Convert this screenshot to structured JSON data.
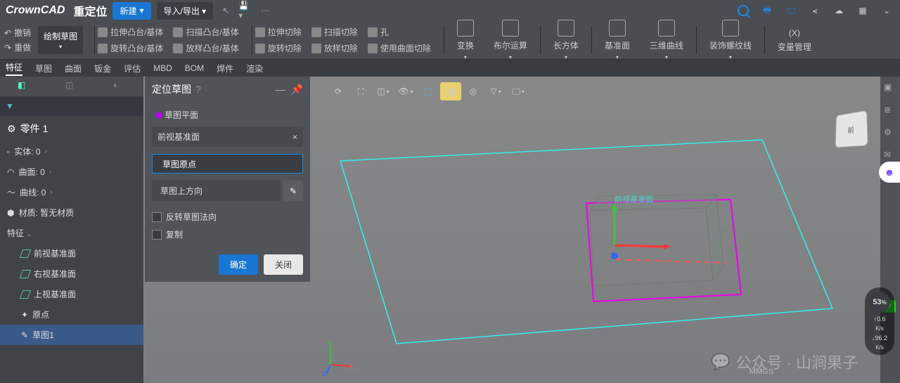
{
  "app": {
    "logo": "CrownCAD",
    "title": "重定位"
  },
  "topbar": {
    "new": "新建",
    "io": "导入/导出"
  },
  "undo": "撤销",
  "redo": "重做",
  "sketch_btn": "绘制草图",
  "tools": {
    "r1": [
      "拉伸凸台/基体",
      "扫描凸台/基体",
      "拉伸切除",
      "扫描切除"
    ],
    "r2": [
      "旋转凸台/基体",
      "放样凸台/基体",
      "旋转切除",
      "放样切除",
      "使用曲面切除"
    ],
    "hole": "孔",
    "big": [
      "变换",
      "布尔运算",
      "长方体",
      "基准面",
      "三维曲线",
      "装饰螺纹线"
    ],
    "var": "(X)",
    "var_label": "变量管理"
  },
  "tabs": [
    "特征",
    "草图",
    "曲面",
    "钣金",
    "评估",
    "MBD",
    "BOM",
    "焊件",
    "渲染"
  ],
  "sidebar": {
    "part": "零件 1",
    "items": [
      "实体: 0",
      "曲面: 0",
      "曲线: 0"
    ],
    "material": "材质: 暂无材质",
    "feature": "特征",
    "planes": [
      "前视基准面",
      "右视基准面",
      "上视基准面"
    ],
    "origin": "原点",
    "sketch": "草图1"
  },
  "panel": {
    "title": "定位草图",
    "plane_label": "草图平面",
    "plane_value": "前视基准面",
    "origin_label": "草图原点",
    "dir_label": "草图上方向",
    "flip": "反转草图法向",
    "copy": "复制",
    "ok": "确定",
    "close": "关闭"
  },
  "viewport": {
    "plane_label": "前视基准面",
    "mmgs": "MMGS"
  },
  "speed": {
    "pct": "53",
    "unit": "%",
    "up": "0.6",
    "down": "96.2",
    "u": "K/s"
  },
  "wm": {
    "prefix": "公众号 · 山涧果子"
  },
  "navcube": "前"
}
